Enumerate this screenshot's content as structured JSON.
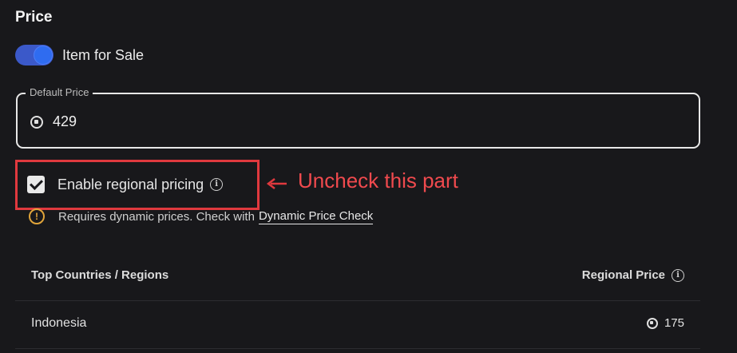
{
  "section": {
    "title": "Price"
  },
  "toggle": {
    "label": "Item for Sale",
    "on": true,
    "accent": "#2f6cf0"
  },
  "default_price": {
    "label": "Default Price",
    "value": "429",
    "icon": "robux-icon"
  },
  "regional": {
    "label": "Enable regional pricing",
    "checked": true,
    "info_icon": "info-icon",
    "warning_text": "Requires dynamic prices. Check with",
    "warning_link": "Dynamic Price Check",
    "warning_color": "#e0a43a"
  },
  "annotation": {
    "text": "Uncheck this part",
    "color": "#e0393e"
  },
  "table": {
    "col_left": "Top Countries / Regions",
    "col_right": "Regional Price",
    "rows": [
      {
        "country": "Indonesia",
        "price": "175"
      }
    ]
  }
}
